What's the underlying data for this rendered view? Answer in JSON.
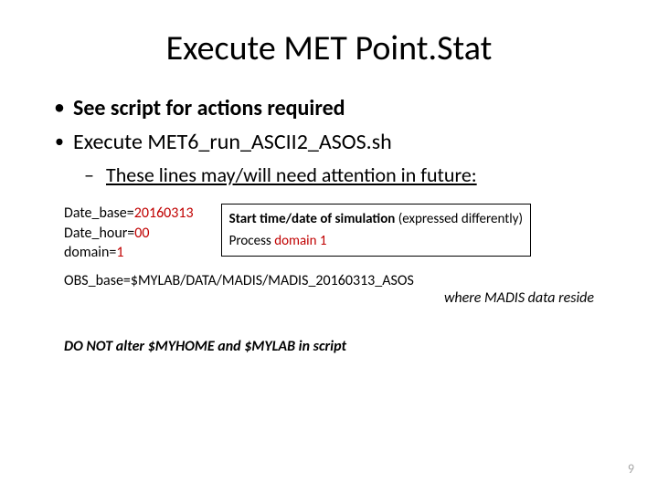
{
  "title": "Execute MET Point.Stat",
  "bullets": {
    "b1": "See script for actions required",
    "b2_pre": "Execute ",
    "b2_code": "MET6_run_ASCII2_ASOS.sh",
    "b3": "These lines may/will need attention in future:"
  },
  "code": {
    "l1a": "Date_base=",
    "l1b": "20160313",
    "l2a": "Date_hour=",
    "l2b": "00",
    "l3a": "domain=",
    "l3b": "1"
  },
  "box": {
    "l1a": "Start time/date of simulation ",
    "l1b": "(expressed differently)",
    "l2a": "Process ",
    "l2b": "domain 1"
  },
  "obs": {
    "line": "OBS_base=$MYLAB/DATA/MADIS/MADIS_20160313_ASOS",
    "note": "where MADIS data reside"
  },
  "warn": "DO NOT alter $MYHOME and $MYLAB in script",
  "slide_num": "9"
}
